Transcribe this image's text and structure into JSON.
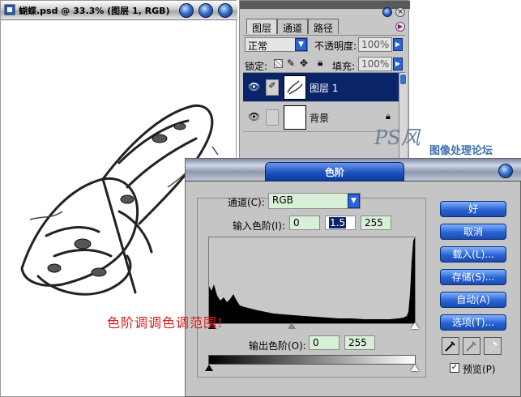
{
  "document": {
    "title": "蝴蝶.psd @ 33.3% (图层 1, RGB)"
  },
  "layers_panel": {
    "tabs": [
      "图层",
      "通道",
      "路径"
    ],
    "blend_mode": "正常",
    "opacity_label": "不透明度:",
    "opacity_value": "100%",
    "lock_label": "锁定:",
    "fill_label": "填充:",
    "fill_value": "100%",
    "layers": [
      {
        "name": "图层 1",
        "selected": true
      },
      {
        "name": "背景",
        "selected": false
      }
    ]
  },
  "watermark": {
    "logo": "PS风",
    "text": "图像处理论坛"
  },
  "levels": {
    "title": "色阶",
    "channel_label": "通道(C):",
    "channel_value": "RGB",
    "input_label": "输入色阶(I):",
    "input_black": "0",
    "input_gamma": "1.5",
    "input_white": "255",
    "output_label": "输出色阶(O):",
    "output_black": "0",
    "output_white": "255",
    "buttons": {
      "ok": "好",
      "cancel": "取消",
      "load": "载入(L)...",
      "save": "存储(S)...",
      "auto": "自动(A)",
      "options": "选项(T)..."
    },
    "preview_label": "预览(P)",
    "preview_checked": true
  },
  "annotation": "色阶调调色调范围!",
  "colors": {
    "accent_blue": "#1c52c4",
    "annotation_red": "#e01818",
    "selected_layer": "#0a246a"
  }
}
